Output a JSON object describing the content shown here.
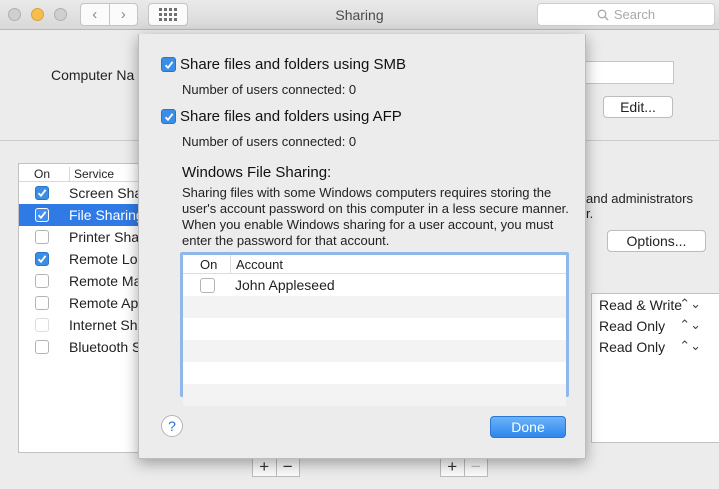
{
  "window": {
    "title": "Sharing",
    "search_placeholder": "Search"
  },
  "background": {
    "computer_name_label": "Computer Na",
    "edit_button": "Edit...",
    "options_button": "Options...",
    "info_text_line1": "and administrators",
    "info_text_line2": "r.",
    "services_header": {
      "on": "On",
      "service": "Service"
    },
    "services": [
      {
        "label": "Screen Sha",
        "checked": true,
        "selected": false
      },
      {
        "label": "File Sharing",
        "checked": true,
        "selected": true
      },
      {
        "label": "Printer Sha",
        "checked": false,
        "selected": false
      },
      {
        "label": "Remote Lo",
        "checked": true,
        "selected": false
      },
      {
        "label": "Remote Ma",
        "checked": false,
        "selected": false
      },
      {
        "label": "Remote Ap",
        "checked": false,
        "selected": false
      },
      {
        "label": "Internet Sh",
        "checked": false,
        "selected": false
      },
      {
        "label": "Bluetooth S",
        "checked": false,
        "selected": false
      }
    ],
    "permissions": [
      "Read & Write",
      "Read Only",
      "Read Only"
    ],
    "stepper_glyph": "⌃⌄"
  },
  "sheet": {
    "smb": {
      "label": "Share files and folders using SMB",
      "checked": true,
      "users": "Number of users connected: 0"
    },
    "afp": {
      "label": "Share files and folders using AFP",
      "checked": true,
      "users": "Number of users connected: 0"
    },
    "windows_title": "Windows File Sharing:",
    "windows_desc": "Sharing files with some Windows computers requires storing the user's account password on this computer in a less secure manner.  When you enable Windows sharing for a user account, you must enter the password for that account.",
    "table_header": {
      "on": "On",
      "account": "Account"
    },
    "accounts": [
      {
        "name": "John Appleseed",
        "checked": false
      }
    ],
    "help_label": "?",
    "done_button": "Done"
  },
  "colors": {
    "accent": "#2f7ae5",
    "checkbox_on": "#3b8ee6",
    "focus_ring": "#8fb7ea"
  }
}
